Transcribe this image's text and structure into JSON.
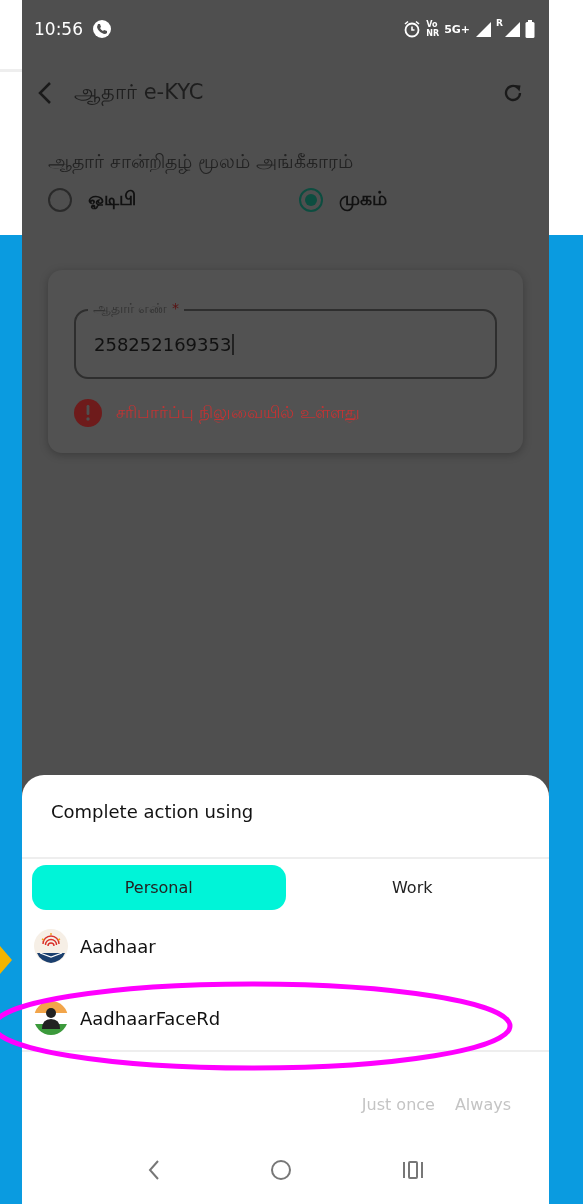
{
  "status_bar": {
    "time": "10:56",
    "volte_top": "Vo",
    "volte_bottom": "NR",
    "network": "5G+",
    "roaming": "R"
  },
  "app_bar": {
    "title": "ஆதார் e-KYC"
  },
  "auth_method": {
    "label": "ஆதார் சான்றிதழ் மூலம் அங்கீகாரம்",
    "options": [
      {
        "label": "ஓடிபி",
        "selected": false
      },
      {
        "label": "முகம்",
        "selected": true
      }
    ]
  },
  "aadhaar_field": {
    "label": "ஆதார் எண்",
    "required_mark": "*",
    "value": "258252169353",
    "error": "சரிபார்ப்பு நிலுவையில் உள்ளது"
  },
  "chooser": {
    "title": "Complete action using",
    "tabs": [
      {
        "label": "Personal",
        "selected": true
      },
      {
        "label": "Work",
        "selected": false
      }
    ],
    "apps": [
      {
        "name": "Aadhaar",
        "kind": "fingerprint"
      },
      {
        "name": "AadhaarFaceRd",
        "kind": "face"
      }
    ],
    "buttons": [
      {
        "label": "Just once",
        "disabled": true
      },
      {
        "label": "Always",
        "disabled": true
      }
    ]
  }
}
